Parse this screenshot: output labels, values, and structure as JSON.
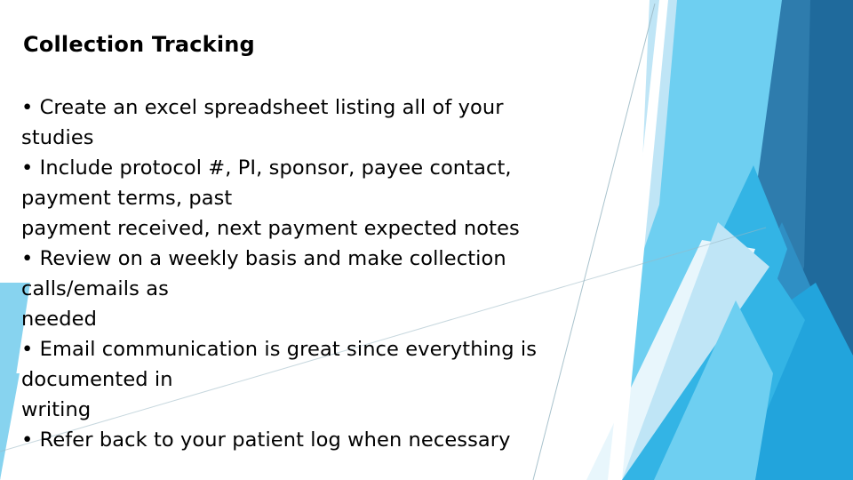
{
  "slide": {
    "title": "Collection Tracking",
    "background_color": "#ffffff",
    "text_color": "#000000",
    "bullet_glyph": "•"
  },
  "body_lines": [
    {
      "bullet": true,
      "text": "• Create an excel spreadsheet listing all of your"
    },
    {
      "bullet": false,
      "text": "studies"
    },
    {
      "bullet": true,
      "text": "• Include protocol #, PI, sponsor, payee contact,"
    },
    {
      "bullet": false,
      "text": "payment terms, past"
    },
    {
      "bullet": false,
      "text": "payment received, next payment expected notes"
    },
    {
      "bullet": true,
      "text": "• Review on a weekly basis and make collection"
    },
    {
      "bullet": false,
      "text": "calls/emails as"
    },
    {
      "bullet": false,
      "text": "needed"
    },
    {
      "bullet": true,
      "text": "• Email communication is great since everything is"
    },
    {
      "bullet": false,
      "text": "documented in"
    },
    {
      "bullet": false,
      "text": "writing"
    },
    {
      "bullet": true,
      "text": "• Refer back to your patient log when necessary"
    }
  ],
  "decoration": {
    "name": "blue-angular-banner",
    "colors": {
      "pale_ice": "#e8f6fc",
      "pale_blue": "#bfe5f6",
      "light_sky": "#87d3ef",
      "sky": "#6ecff1",
      "azure": "#33b4e5",
      "bright_azure": "#22a4dc",
      "mid_blue": "#2f8fc4",
      "steel_blue": "#2e7cad",
      "deep_blue": "#1f6a9c",
      "hairline": "#9ab8c4",
      "white": "#ffffff"
    }
  }
}
